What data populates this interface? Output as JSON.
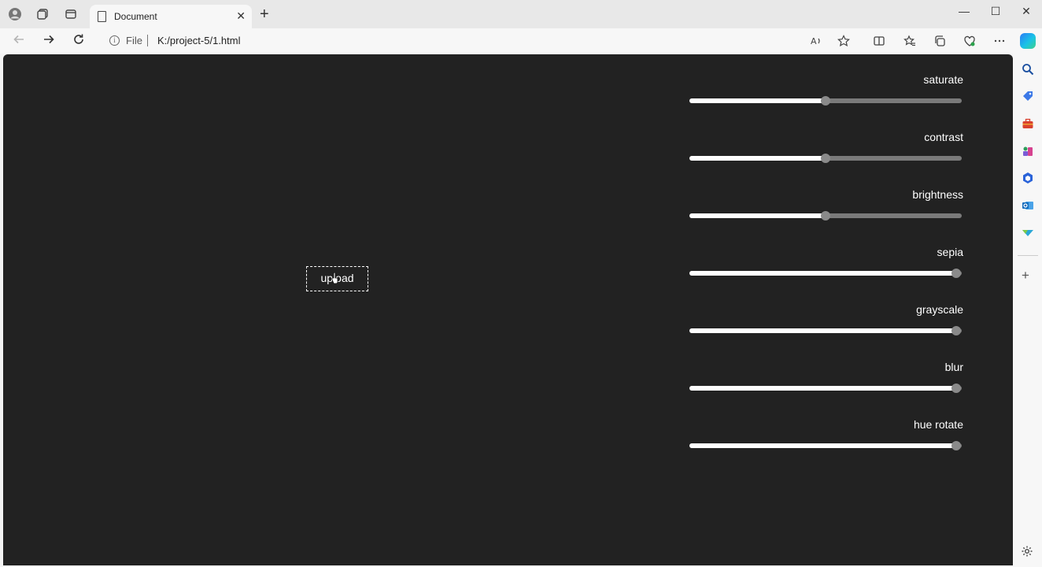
{
  "tab": {
    "title": "Document",
    "close": "✕"
  },
  "window_controls": {
    "minimize": "—",
    "maximize": "☐",
    "close": "✕"
  },
  "address": {
    "scheme_label": "File",
    "url": "K:/project-5/1.html"
  },
  "page": {
    "upload_label": "upload",
    "controls": [
      {
        "label": "saturate",
        "value_fraction": 0.5
      },
      {
        "label": "contrast",
        "value_fraction": 0.5
      },
      {
        "label": "brightness",
        "value_fraction": 0.5
      },
      {
        "label": "sepia",
        "value_fraction": 0.98
      },
      {
        "label": "grayscale",
        "value_fraction": 0.98
      },
      {
        "label": "blur",
        "value_fraction": 0.98
      },
      {
        "label": "hue rotate",
        "value_fraction": 0.98
      }
    ]
  },
  "icons": {
    "back": "back-arrow-icon",
    "forward": "forward-arrow-icon",
    "refresh": "refresh-icon",
    "read_aloud": "read-aloud-icon",
    "favorite": "star-icon",
    "split": "split-screen-icon",
    "favorites": "favorites-icon",
    "collections": "collections-icon",
    "heart": "browser-essentials-icon",
    "more": "more-icon",
    "copilot": "copilot-icon"
  },
  "colors": {
    "page_bg": "#222222",
    "accent_copilot": "#2a7cf6"
  }
}
